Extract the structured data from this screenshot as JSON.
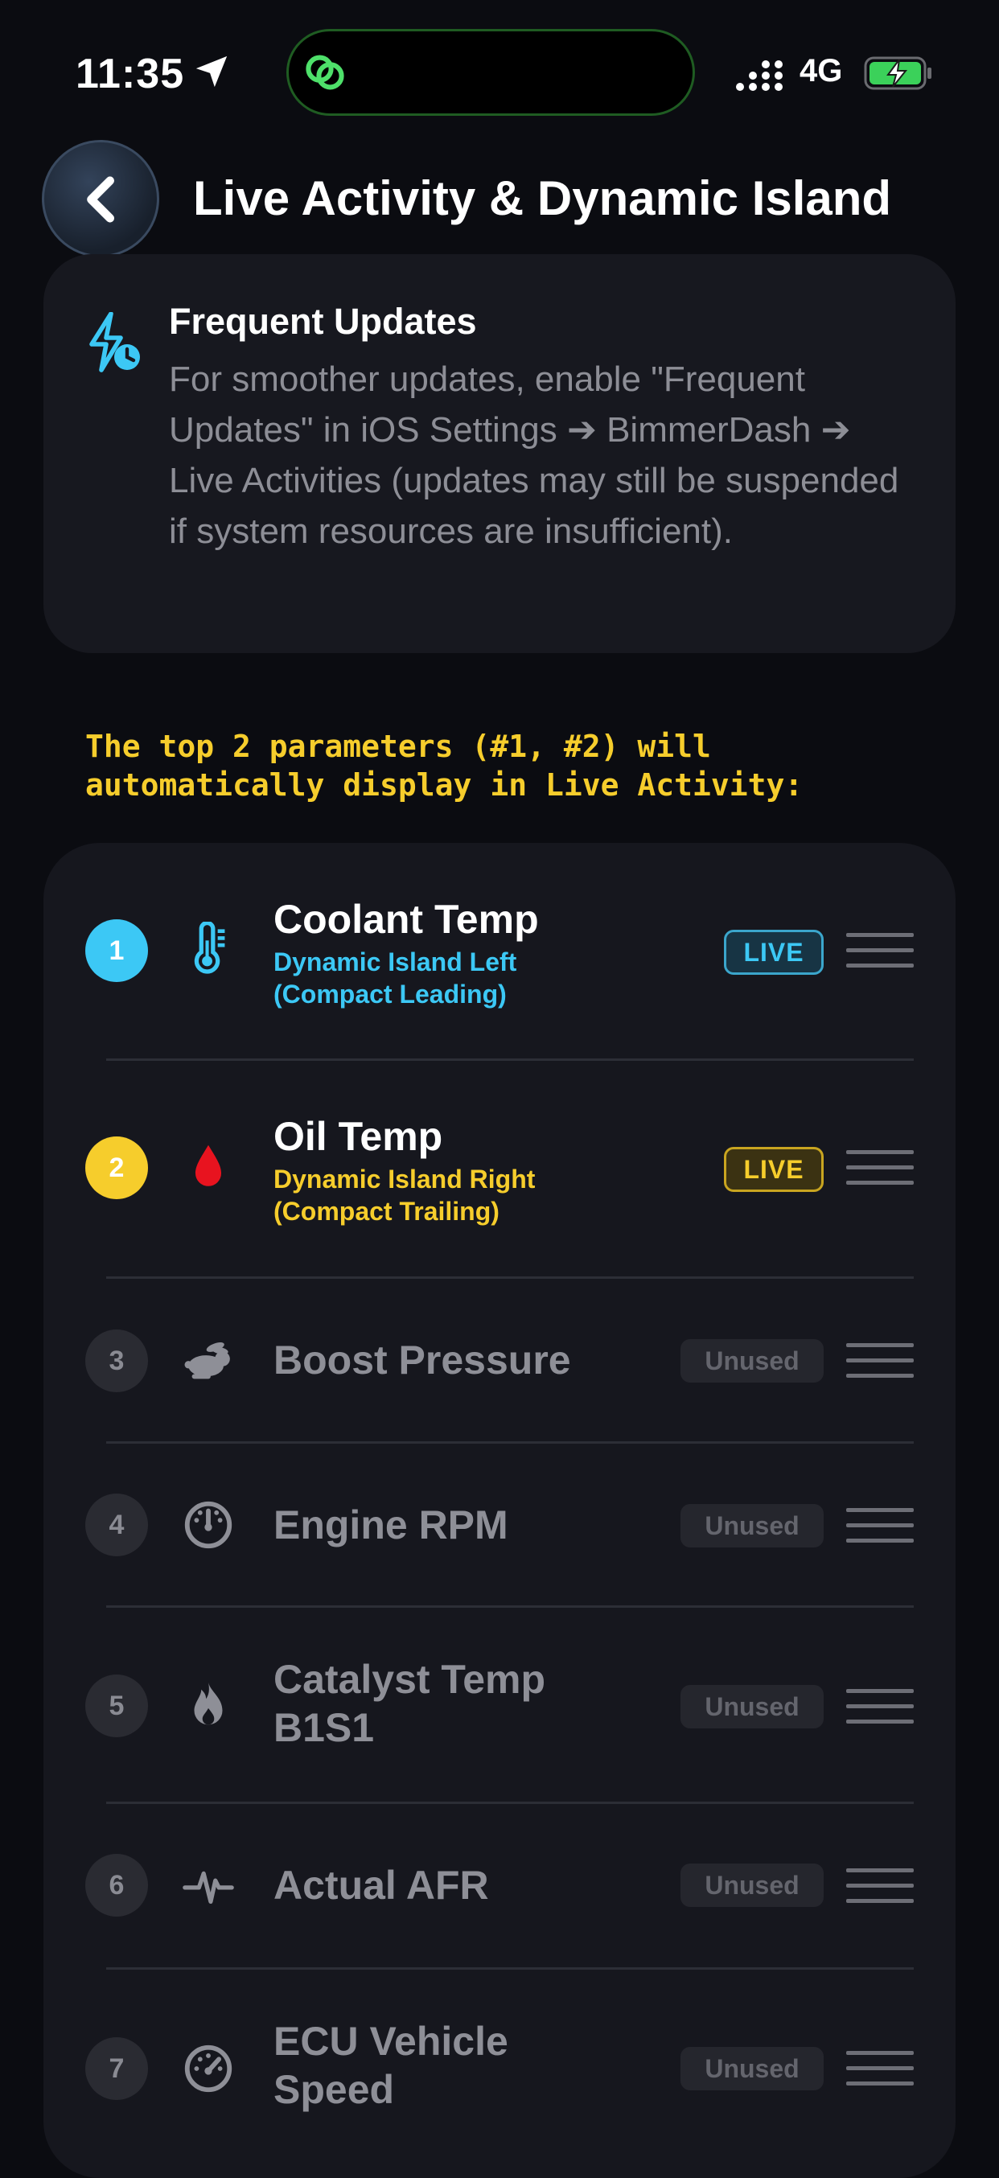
{
  "status_bar": {
    "time": "11:35",
    "network": "4G"
  },
  "header": {
    "title": "Live Activity & Dynamic Island"
  },
  "info": {
    "title": "Frequent Updates",
    "text": "For smoother updates, enable \"Frequent Updates\" in iOS Settings ➔ BimmerDash ➔ Live Activities (updates may still be suspended if system resources are insufficient)."
  },
  "note": {
    "line1": "The top 2 parameters (#1, #2) will",
    "line2": "automatically display in Live Activity:"
  },
  "colors": {
    "accent_blue": "#3cc8f5",
    "accent_yellow": "#f6cd2c",
    "background": "#0b0c11",
    "card": "#16171e"
  },
  "parameters": [
    {
      "rank": "1",
      "name": "Coolant Temp",
      "sub1": "Dynamic Island Left",
      "sub2": "(Compact Leading)",
      "badge": "LIVE",
      "icon": "thermometer-icon"
    },
    {
      "rank": "2",
      "name": "Oil Temp",
      "sub1": "Dynamic Island Right",
      "sub2": "(Compact Trailing)",
      "badge": "LIVE",
      "icon": "oil-drop-icon"
    },
    {
      "rank": "3",
      "name": "Boost Pressure",
      "badge": "Unused",
      "icon": "rabbit-icon"
    },
    {
      "rank": "4",
      "name": "Engine RPM",
      "badge": "Unused",
      "icon": "gauge-icon"
    },
    {
      "rank": "5",
      "name_line1": "Catalyst Temp",
      "name_line2": "B1S1",
      "badge": "Unused",
      "icon": "flame-icon"
    },
    {
      "rank": "6",
      "name": "Actual AFR",
      "badge": "Unused",
      "icon": "waveform-icon"
    },
    {
      "rank": "7",
      "name_line1": "ECU Vehicle",
      "name_line2": "Speed",
      "badge": "Unused",
      "icon": "speedometer-icon"
    }
  ]
}
